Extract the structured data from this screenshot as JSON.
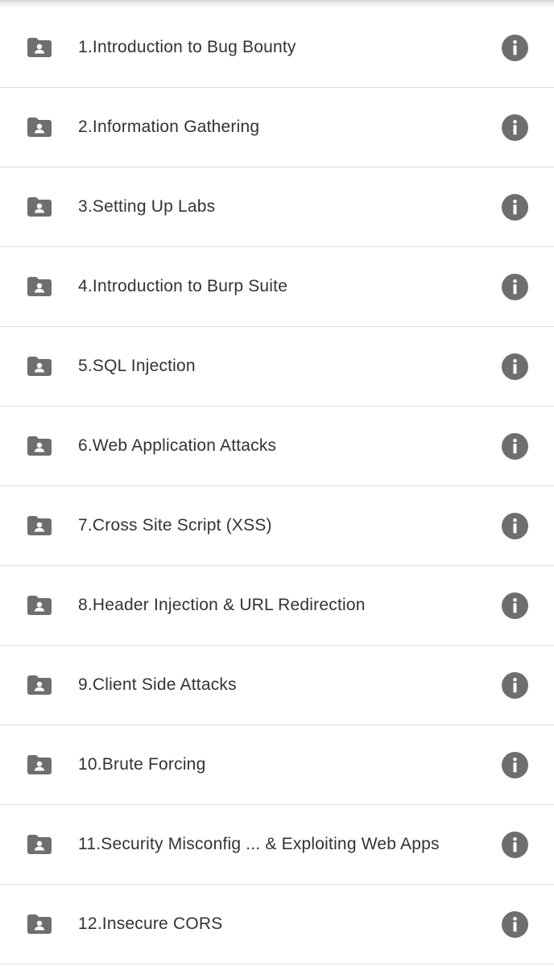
{
  "colors": {
    "icon": "#6e6e6e",
    "text": "#333333",
    "divider": "#dcdcdc",
    "background": "#ffffff"
  },
  "icons": {
    "row_icon": "shared-folder-icon",
    "action_icon": "info-icon"
  },
  "folders": [
    {
      "label": "1.Introduction to Bug Bounty"
    },
    {
      "label": "2.Information Gathering"
    },
    {
      "label": "3.Setting Up Labs"
    },
    {
      "label": "4.Introduction to Burp Suite"
    },
    {
      "label": "5.SQL Injection"
    },
    {
      "label": "6.Web Application Attacks"
    },
    {
      "label": "7.Cross Site Script (XSS)"
    },
    {
      "label": "8.Header Injection & URL Redirection"
    },
    {
      "label": "9.Client Side Attacks"
    },
    {
      "label": "10.Brute Forcing"
    },
    {
      "label": "11.Security Misconfig ... & Exploiting Web Apps"
    },
    {
      "label": "12.Insecure CORS"
    }
  ]
}
